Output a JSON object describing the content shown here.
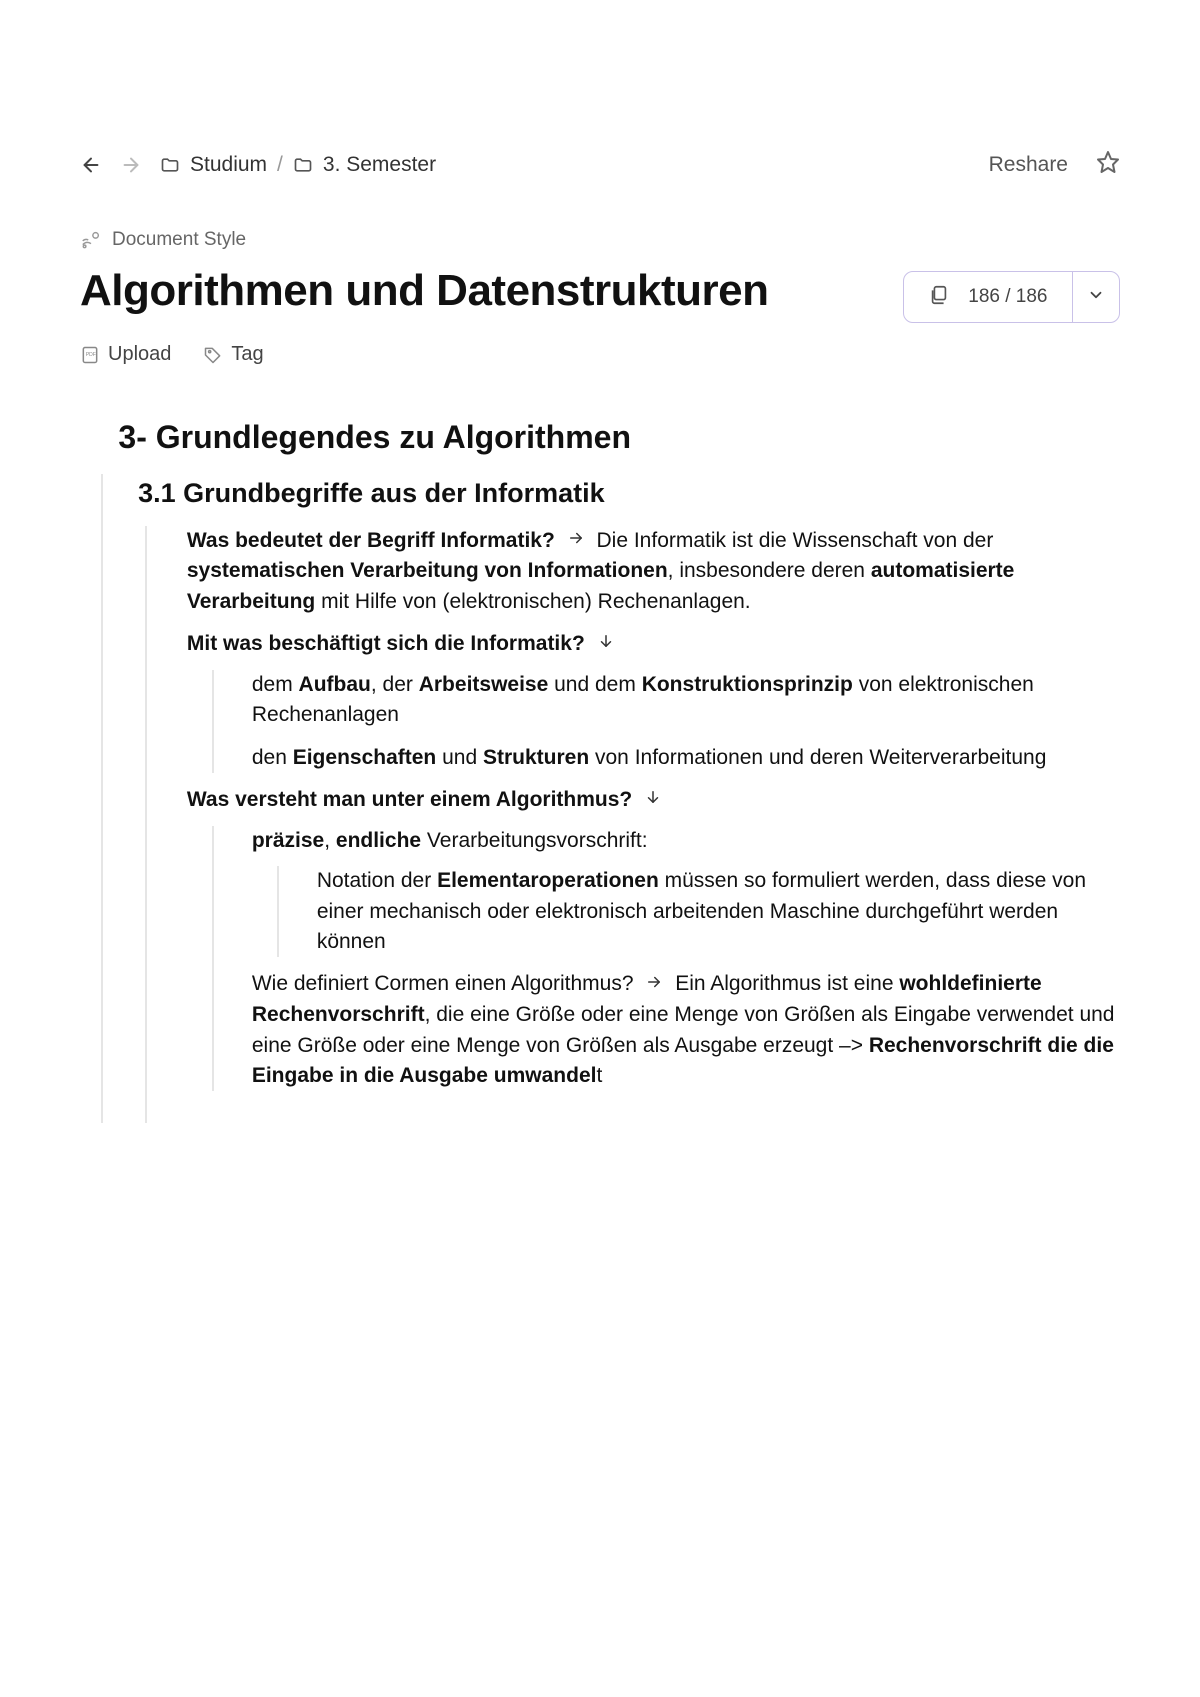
{
  "breadcrumb": {
    "folder1": "Studium",
    "folder2": "3. Semester"
  },
  "reshare_label": "Reshare",
  "doc_style_label": "Document Style",
  "page_title": "Algorithmen und Datenstrukturen",
  "cards_count": "186 / 186",
  "actions": {
    "upload": "Upload",
    "tag": "Tag"
  },
  "outline": {
    "h2": "3- Grundlegendes zu Algorithmen",
    "h3": "3.1 Grundbegriffe aus der Informatik",
    "q1_lead": "Was bedeutet der Begriff Informatik?",
    "q1_a_pre": "Die Informatik ist die Wissenschaft von der ",
    "q1_a_b1": "systematischen Verarbeitung von Informationen",
    "q1_a_mid": ", insbesondere deren ",
    "q1_a_b2": "automatisierte Verarbeitung",
    "q1_a_post": " mit Hilfe von (elektronischen) Rechenanlagen.",
    "q2_lead": "Mit was beschäftigt sich die Informatik?",
    "q2_1_pre": "dem ",
    "q2_1_b1": "Aufbau",
    "q2_1_mid1": ", der ",
    "q2_1_b2": "Arbeitsweise",
    "q2_1_mid2": " und dem ",
    "q2_1_b3": "Konstruktionsprinzip",
    "q2_1_post": " von elektronischen Rechenanlagen",
    "q2_2_pre": "den ",
    "q2_2_b1": "Eigenschaften",
    "q2_2_mid": " und ",
    "q2_2_b2": "Strukturen",
    "q2_2_post": " von Informationen und deren Weiterverarbeitung",
    "q3_lead": "Was versteht man unter einem Algorithmus?",
    "q3_1_b1": "präzise",
    "q3_1_mid": ", ",
    "q3_1_b2": "endliche",
    "q3_1_post": " Verarbeitungsvorschrift:",
    "q3_1a_pre": "Notation der ",
    "q3_1a_b": "Elementaroperationen",
    "q3_1a_post": " müssen so formuliert werden, dass diese von einer mechanisch oder elektronisch arbeitenden Maschine durchgeführt werden können",
    "q4_lead": "Wie definiert Cormen einen Algorithmus?",
    "q4_a_pre": "Ein Algorithmus ist eine ",
    "q4_a_b1": "wohldefinierte Rechenvorschrift",
    "q4_a_mid": ", die eine Größe oder eine Menge von Größen als Eingabe verwendet und eine Größe oder eine Menge von Größen als Ausgabe erzeugt –> ",
    "q4_a_b2": "Rechenvorschrift die die Eingabe in die Ausgabe umwandel",
    "q4_a_post": "t"
  }
}
